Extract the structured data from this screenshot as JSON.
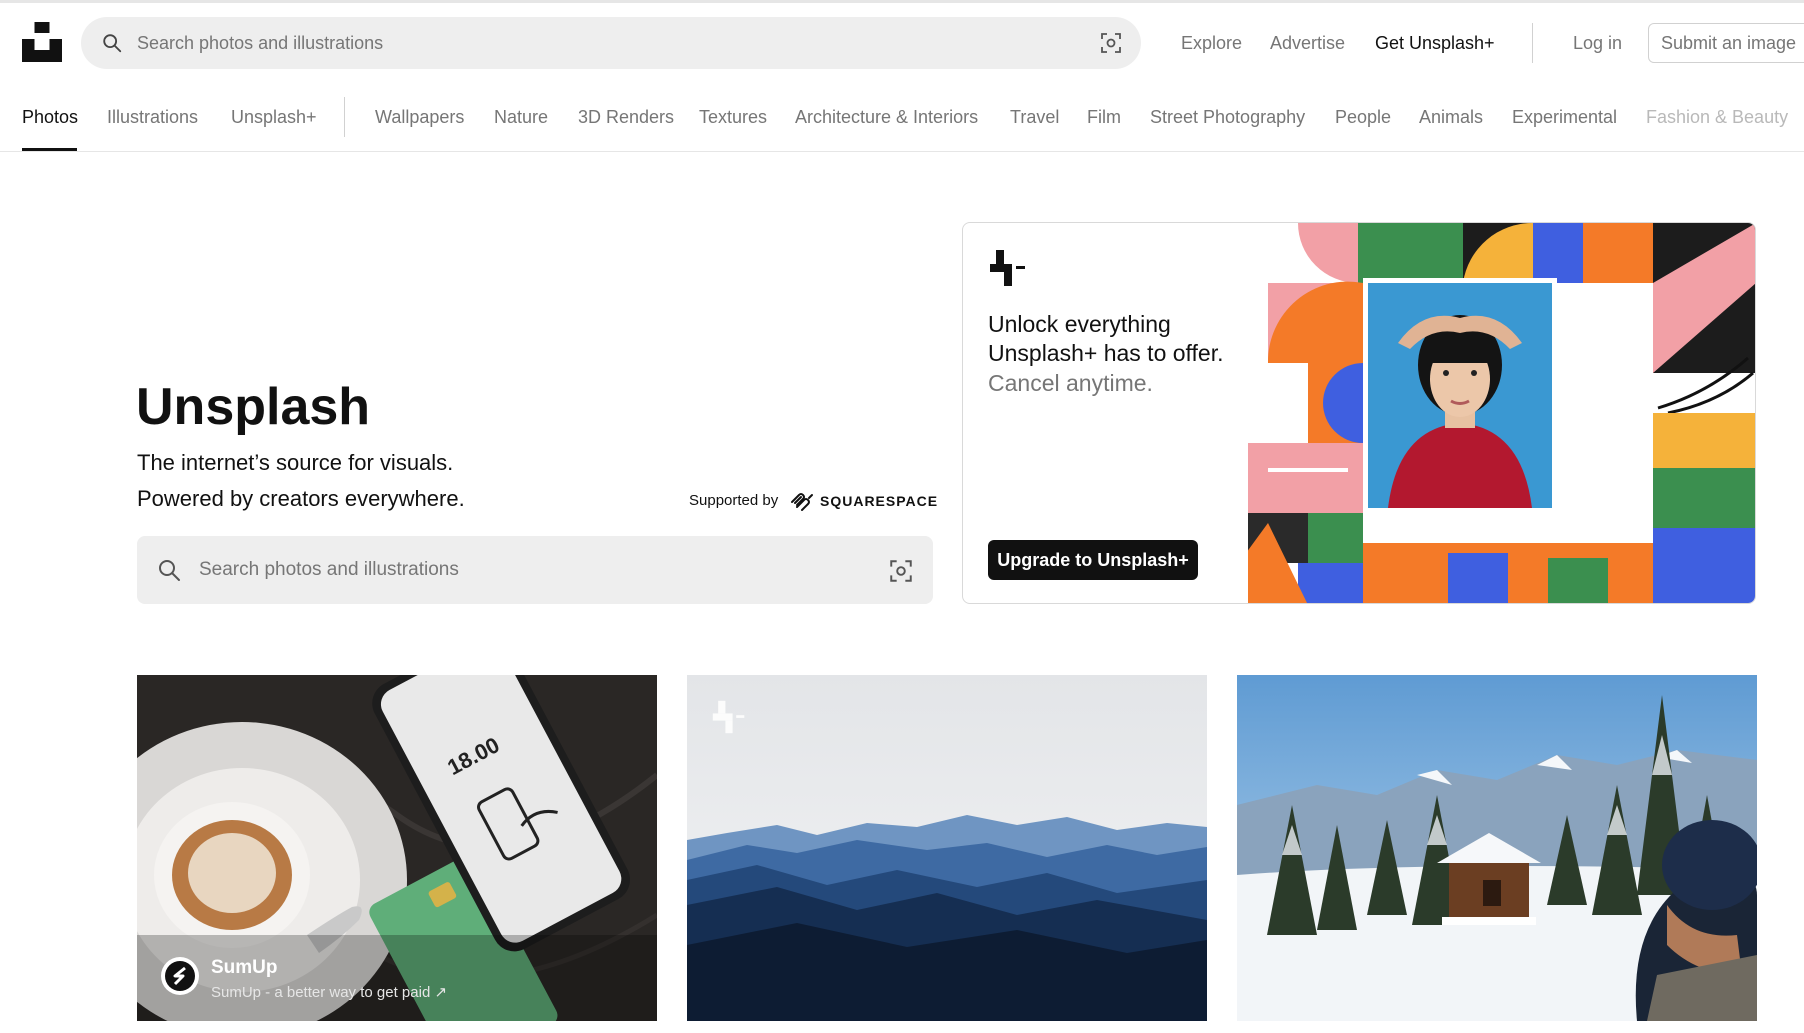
{
  "header": {
    "search_placeholder": "Search photos and illustrations",
    "nav": {
      "explore": "Explore",
      "advertise": "Advertise",
      "get_plus": "Get Unsplash+"
    },
    "login": "Log in",
    "submit": "Submit an image"
  },
  "tabs": {
    "photos": "Photos",
    "illustrations": "Illustrations",
    "unsplash_plus": "Unsplash+",
    "topics": [
      "Wallpapers",
      "Nature",
      "3D Renders",
      "Textures",
      "Architecture & Interiors",
      "Travel",
      "Film",
      "Street Photography",
      "People",
      "Animals",
      "Experimental",
      "Fashion & Beauty"
    ]
  },
  "hero": {
    "title": "Unsplash",
    "line1": "The internet’s source for visuals.",
    "line2": "Powered by creators everywhere.",
    "supported_by": "Supported by",
    "sponsor": "SQUARESPACE",
    "search_placeholder": "Search photos and illustrations"
  },
  "promo": {
    "line1": "Unlock everything",
    "line2": "Unsplash+ has to offer.",
    "line3": "Cancel anytime.",
    "button": "Upgrade to Unsplash+"
  },
  "photos": {
    "sponsor_name": "SumUp",
    "sponsor_tagline": "SumUp - a better way to get paid ↗",
    "phone_amount": "18.00"
  },
  "colors": {
    "text": "#111111",
    "muted": "#767676",
    "search_bg": "#eeeeee",
    "border": "#d1d1d1"
  },
  "icons": [
    "unsplash-logo-icon",
    "search-icon",
    "visual-search-icon",
    "squarespace-logo-icon",
    "unsplash-plus-icon"
  ]
}
